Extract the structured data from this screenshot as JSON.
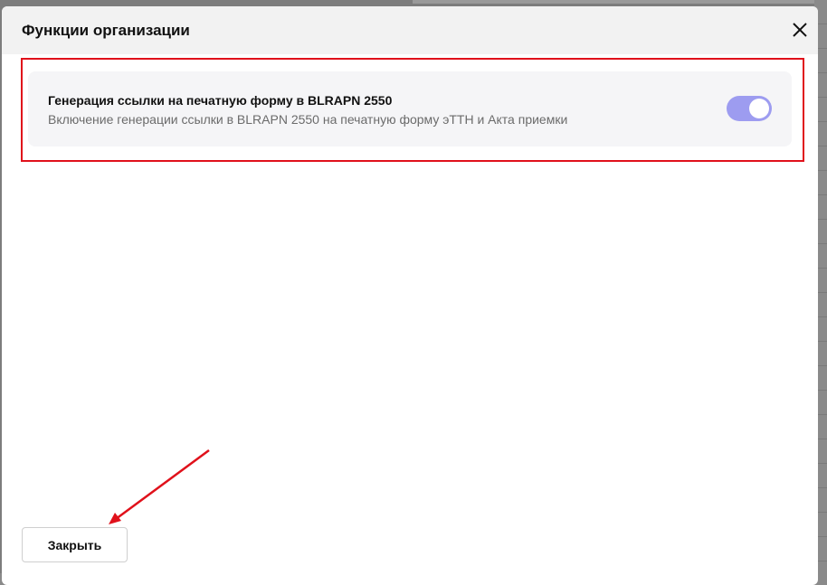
{
  "modal": {
    "title": "Функции организации",
    "close_icon": "close-icon"
  },
  "feature": {
    "title": "Генерация ссылки на печатную форму в BLRAPN 2550",
    "description": "Включение генерации ссылки в BLRAPN 2550 на печатную форму эТТН и Акта приемки",
    "enabled": true
  },
  "footer": {
    "close_label": "Закрыть"
  },
  "colors": {
    "highlight": "#e0111b",
    "toggle_on": "#9d9cf0",
    "arrow": "#e0111b"
  }
}
